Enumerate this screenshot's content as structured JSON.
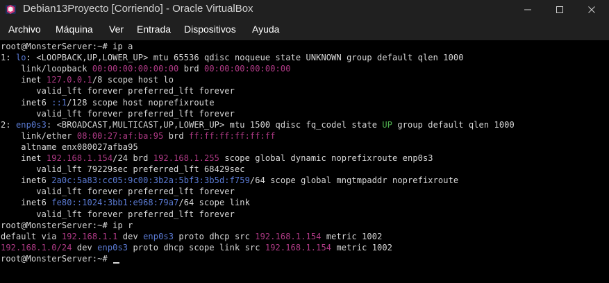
{
  "window": {
    "title": "Debian13Proyecto [Corriendo] - Oracle VirtualBox",
    "app_icon": "virtualbox-icon",
    "controls": [
      "minimize-icon",
      "maximize-icon",
      "close-icon"
    ]
  },
  "menu": {
    "items": [
      "Archivo",
      "Máquina",
      "Ver",
      "Entrada",
      "Dispositivos",
      "Ayuda"
    ]
  },
  "terminal": {
    "colors": {
      "text": "#d9d9d9",
      "iface": "#5b7bd5",
      "addr": "#b03a86",
      "state_up": "#4fb04f"
    },
    "lines": [
      [
        {
          "t": "root@MonsterServer:~# ip a"
        }
      ],
      [
        {
          "t": "1: "
        },
        {
          "t": "lo",
          "c": "blue"
        },
        {
          "t": ": <LOOPBACK,UP,LOWER_UP> mtu 65536 qdisc noqueue state UNKNOWN group default qlen 1000"
        }
      ],
      [
        {
          "t": "    link/loopback "
        },
        {
          "t": "00:00:00:00:00:00",
          "c": "pink"
        },
        {
          "t": " brd "
        },
        {
          "t": "00:00:00:00:00:00",
          "c": "pink"
        }
      ],
      [
        {
          "t": "    inet "
        },
        {
          "t": "127.0.0.1",
          "c": "pink"
        },
        {
          "t": "/8 scope host lo"
        }
      ],
      [
        {
          "t": "       valid_lft forever preferred_lft forever"
        }
      ],
      [
        {
          "t": "    inet6 "
        },
        {
          "t": "::1",
          "c": "blue"
        },
        {
          "t": "/128 scope host noprefixroute"
        }
      ],
      [
        {
          "t": "       valid_lft forever preferred_lft forever"
        }
      ],
      [
        {
          "t": "2: "
        },
        {
          "t": "enp0s3",
          "c": "blue"
        },
        {
          "t": ": <BROADCAST,MULTICAST,UP,LOWER_UP> mtu 1500 qdisc fq_codel state "
        },
        {
          "t": "UP",
          "c": "green"
        },
        {
          "t": " group default qlen 1000"
        }
      ],
      [
        {
          "t": "    link/ether "
        },
        {
          "t": "08:00:27:af:ba:95",
          "c": "pink"
        },
        {
          "t": " brd "
        },
        {
          "t": "ff:ff:ff:ff:ff:ff",
          "c": "pink"
        }
      ],
      [
        {
          "t": "    altname enx080027afba95"
        }
      ],
      [
        {
          "t": "    inet "
        },
        {
          "t": "192.168.1.154",
          "c": "pink"
        },
        {
          "t": "/24 brd "
        },
        {
          "t": "192.168.1.255",
          "c": "pink"
        },
        {
          "t": " scope global dynamic noprefixroute enp0s3"
        }
      ],
      [
        {
          "t": "       valid_lft 79229sec preferred_lft 68429sec"
        }
      ],
      [
        {
          "t": "    inet6 "
        },
        {
          "t": "2a0c:5a83:cc05:9c00:3b2a:5bf3:3b5d:f759",
          "c": "blue"
        },
        {
          "t": "/64 scope global mngtmpaddr noprefixroute"
        }
      ],
      [
        {
          "t": "       valid_lft forever preferred_lft forever"
        }
      ],
      [
        {
          "t": "    inet6 "
        },
        {
          "t": "fe80::1024:3bb1:e968:79a7",
          "c": "blue"
        },
        {
          "t": "/64 scope link"
        }
      ],
      [
        {
          "t": "       valid_lft forever preferred_lft forever"
        }
      ],
      [
        {
          "t": "root@MonsterServer:~# ip r"
        }
      ],
      [
        {
          "t": "default via "
        },
        {
          "t": "192.168.1.1",
          "c": "pink"
        },
        {
          "t": " dev "
        },
        {
          "t": "enp0s3",
          "c": "blue"
        },
        {
          "t": " proto dhcp src "
        },
        {
          "t": "192.168.1.154",
          "c": "pink"
        },
        {
          "t": " metric 1002"
        }
      ],
      [
        {
          "t": "192.168.1.0/24",
          "c": "pink"
        },
        {
          "t": " dev "
        },
        {
          "t": "enp0s3",
          "c": "blue"
        },
        {
          "t": " proto dhcp scope link src "
        },
        {
          "t": "192.168.1.154",
          "c": "pink"
        },
        {
          "t": " metric 1002"
        }
      ],
      [
        {
          "t": "root@MonsterServer:~# "
        }
      ]
    ]
  }
}
